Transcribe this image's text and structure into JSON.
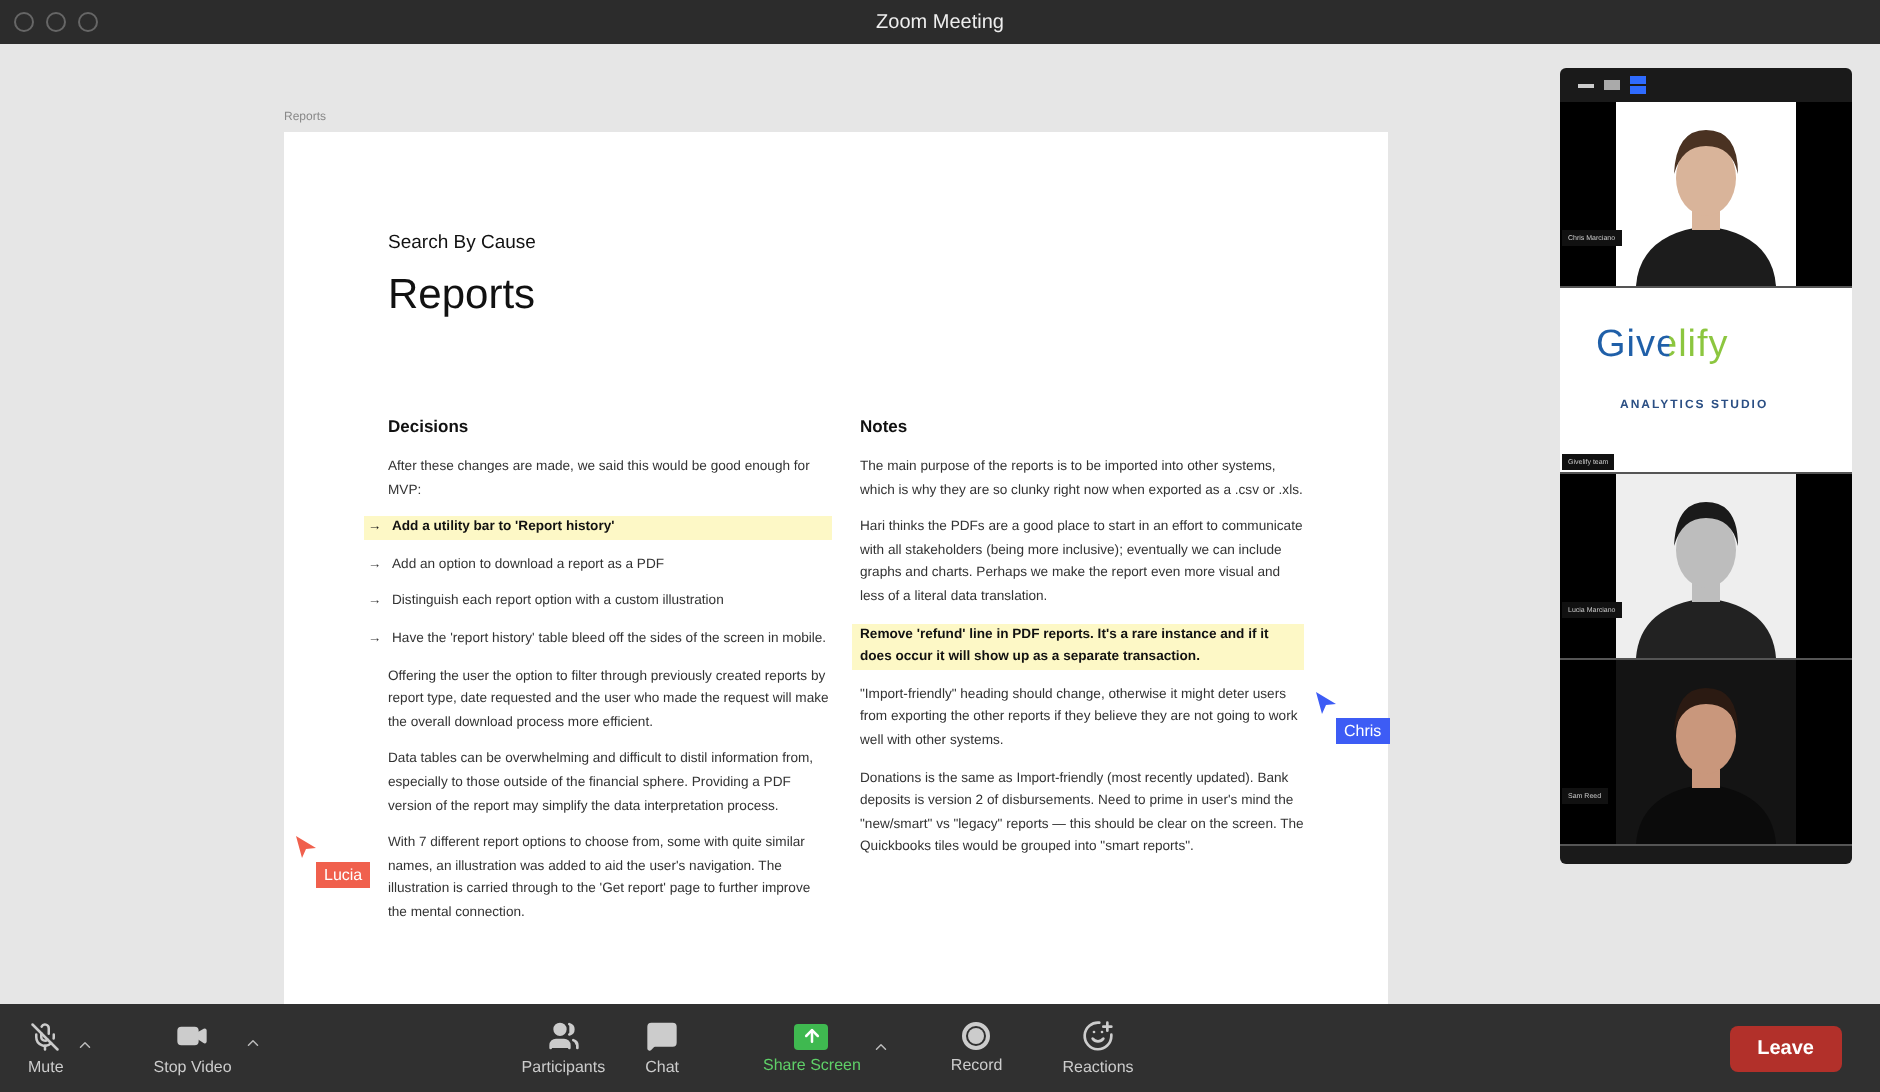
{
  "window": {
    "title": "Zoom Meeting"
  },
  "document": {
    "frame_label": "Reports",
    "eyebrow": "Search By Cause",
    "title": "Reports",
    "columns": [
      {
        "heading": "Decisions",
        "blocks": [
          {
            "kind": "paragraph",
            "text": "After these changes are made, we said this would be good enough for MVP:",
            "highlighted": false
          },
          {
            "kind": "bullet",
            "marker": "→",
            "text": "Add a utility bar to 'Report history'",
            "highlighted": true
          },
          {
            "kind": "bullet",
            "marker": "→",
            "text": "Add an option to download a report as a PDF",
            "highlighted": false
          },
          {
            "kind": "bullet",
            "marker": "→",
            "text": "Distinguish each report option with a custom illustration",
            "highlighted": false
          },
          {
            "kind": "bullet",
            "marker": "→",
            "text": "Have the 'report history' table bleed off the sides of the screen in mobile.",
            "highlighted": false
          },
          {
            "kind": "paragraph",
            "text": "Offering the user the option to filter through previously created reports by report type, date requested and the user who made the request will make the overall download process more efficient.",
            "highlighted": false
          },
          {
            "kind": "paragraph",
            "text": "Data tables can be overwhelming and difficult to distil information from, especially to those outside of the financial sphere. Providing a PDF version of the report may simplify the data interpretation process.",
            "highlighted": false
          },
          {
            "kind": "paragraph",
            "text": "With 7 different report options to choose from, some with quite similar names, an illustration was added to aid the user's navigation. The illustration is carried through to the 'Get report' page to further improve the mental connection.",
            "highlighted": false
          }
        ]
      },
      {
        "heading": "Notes",
        "blocks": [
          {
            "kind": "paragraph",
            "text": "The main purpose of the reports is to be imported into other systems, which is why they are so clunky right now when exported as a .csv or .xls.",
            "highlighted": false
          },
          {
            "kind": "paragraph",
            "text": "Hari thinks the PDFs are a good place to start in an effort to communicate with all stakeholders (being more inclusive); eventually we can include graphs and charts. Perhaps we make the report even more visual and less of a literal data translation.",
            "highlighted": false
          },
          {
            "kind": "paragraph",
            "text": "Remove 'refund' line in PDF reports. It's a rare instance and if it does occur it will show up as a separate transaction.",
            "highlighted": true
          },
          {
            "kind": "paragraph",
            "text": "\"Import-friendly\" heading should change, otherwise it might deter users from exporting the other reports if they believe they are not going to work well with other systems.",
            "highlighted": false
          },
          {
            "kind": "paragraph",
            "text": "Donations is the same as Import-friendly (most recently updated). Bank deposits is version 2 of disbursements. Need to prime in user's mind the \"new/smart\" vs \"legacy\" reports — this should be clear on the screen. The Quickbooks tiles would be grouped into \"smart reports\".",
            "highlighted": false
          }
        ]
      }
    ]
  },
  "cursors": [
    {
      "label": "Lucia",
      "color": "#f0604d"
    },
    {
      "label": "Chris",
      "color": "#3d5cf5"
    }
  ],
  "gallery": {
    "tiles": [
      {
        "kind": "person",
        "name": "Chris Marciano"
      },
      {
        "kind": "logo",
        "name": "Givelify team",
        "brand": "Givelify",
        "subtitle": "ANALYTICS STUDIO"
      },
      {
        "kind": "person",
        "name": "Lucia Marciano"
      },
      {
        "kind": "person",
        "name": "Sam Reed"
      }
    ]
  },
  "toolbar": {
    "items": [
      {
        "kind": "mute",
        "label": "Mute",
        "has_menu": true
      },
      {
        "kind": "video",
        "label": "Stop Video",
        "has_menu": true
      },
      {
        "kind": "participants",
        "label": "Participants",
        "has_menu": false
      },
      {
        "kind": "chat",
        "label": "Chat",
        "has_menu": false
      },
      {
        "kind": "share",
        "label": "Share Screen",
        "has_menu": true
      },
      {
        "kind": "record",
        "label": "Record",
        "has_menu": false
      },
      {
        "kind": "reactions",
        "label": "Reactions",
        "has_menu": false
      }
    ],
    "leave": "Leave"
  }
}
